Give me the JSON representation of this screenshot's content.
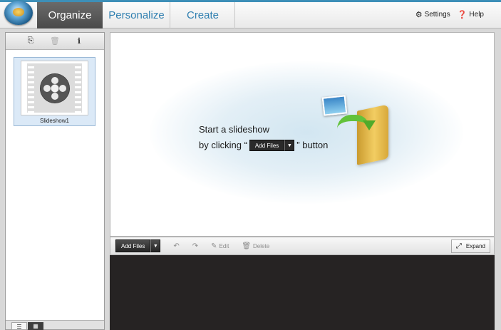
{
  "tabs": [
    {
      "label": "Organize",
      "active": true
    },
    {
      "label": "Personalize",
      "active": false
    },
    {
      "label": "Create",
      "active": false
    }
  ],
  "header_links": {
    "settings": {
      "label": "Settings",
      "icon": "gear-icon"
    },
    "help": {
      "label": "Help",
      "icon": "help-circle-icon"
    }
  },
  "left_toolbar": {
    "icons": [
      "add-to-slideshow-icon",
      "trash-icon",
      "info-icon"
    ]
  },
  "slideshows": [
    {
      "label": "Slideshow1",
      "icon": "film-reel-icon",
      "selected": true
    }
  ],
  "view_toggle": {
    "icons": [
      "list-view-icon",
      "thumbnail-view-icon"
    ],
    "active": "thumbnail-view-icon"
  },
  "empty_state": {
    "line1": "Start a slideshow",
    "line2_prefix": "by clicking “",
    "button_label": "Add Files",
    "line2_suffix": "” button"
  },
  "bottom_toolbar": {
    "add_files_label": "Add Files",
    "rotate_left_icon": "rotate-left-icon",
    "rotate_right_icon": "rotate-right-icon",
    "edit_label": "Edit",
    "delete_label": "Delete",
    "expand_label": "Expand"
  },
  "colors": {
    "accent": "#3d8fb8",
    "tab_text": "#2f7fb0",
    "active_tab": "#575757",
    "selection": "#dbe9f7",
    "dark_strip": "#262323"
  }
}
